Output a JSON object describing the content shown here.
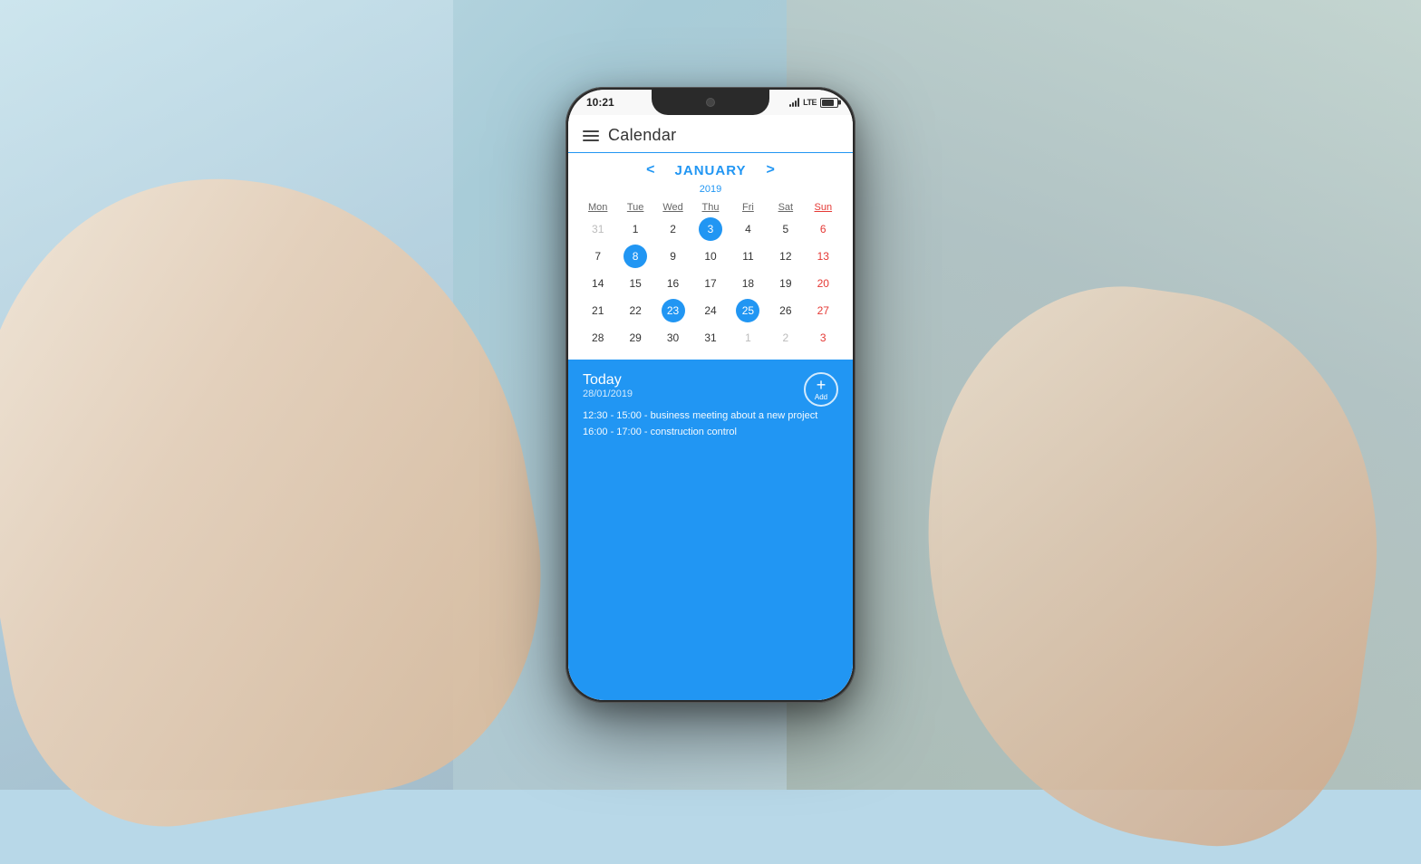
{
  "background": {
    "color_left": "#c8dde8",
    "color_right": "#b8c8c0"
  },
  "phone": {
    "status_bar": {
      "time": "10:21",
      "lte": "LTE"
    },
    "app": {
      "title": "Calendar",
      "month": "JANUARY",
      "year": "2019",
      "nav_prev": "<",
      "nav_next": ">",
      "day_headers": [
        "Mon",
        "Tue",
        "Wed",
        "Thu",
        "Fri",
        "Sat",
        "Sun"
      ],
      "weeks": [
        [
          {
            "day": "31",
            "type": "other-month"
          },
          {
            "day": "1",
            "type": "normal"
          },
          {
            "day": "2",
            "type": "normal"
          },
          {
            "day": "3",
            "type": "highlighted"
          },
          {
            "day": "4",
            "type": "normal"
          },
          {
            "day": "5",
            "type": "normal"
          },
          {
            "day": "6",
            "type": "sunday"
          }
        ],
        [
          {
            "day": "7",
            "type": "normal"
          },
          {
            "day": "8",
            "type": "highlighted"
          },
          {
            "day": "9",
            "type": "normal"
          },
          {
            "day": "10",
            "type": "normal"
          },
          {
            "day": "11",
            "type": "normal"
          },
          {
            "day": "12",
            "type": "normal"
          },
          {
            "day": "13",
            "type": "sunday"
          }
        ],
        [
          {
            "day": "14",
            "type": "normal"
          },
          {
            "day": "15",
            "type": "normal"
          },
          {
            "day": "16",
            "type": "normal"
          },
          {
            "day": "17",
            "type": "normal"
          },
          {
            "day": "18",
            "type": "normal"
          },
          {
            "day": "19",
            "type": "normal"
          },
          {
            "day": "20",
            "type": "sunday"
          }
        ],
        [
          {
            "day": "21",
            "type": "normal"
          },
          {
            "day": "22",
            "type": "normal"
          },
          {
            "day": "23",
            "type": "highlighted"
          },
          {
            "day": "24",
            "type": "normal"
          },
          {
            "day": "25",
            "type": "highlighted"
          },
          {
            "day": "26",
            "type": "normal"
          },
          {
            "day": "27",
            "type": "sunday"
          }
        ],
        [
          {
            "day": "28",
            "type": "normal"
          },
          {
            "day": "29",
            "type": "normal"
          },
          {
            "day": "30",
            "type": "normal"
          },
          {
            "day": "31",
            "type": "normal"
          },
          {
            "day": "1",
            "type": "other-month"
          },
          {
            "day": "2",
            "type": "other-month"
          },
          {
            "day": "3",
            "type": "other-month sunday"
          }
        ]
      ],
      "events": {
        "today_label": "Today",
        "today_date": "28/01/2019",
        "add_label": "Add",
        "items": [
          "12:30 - 15:00 - business meeting about a new project",
          "16:00 - 17:00 - construction control"
        ]
      }
    }
  }
}
